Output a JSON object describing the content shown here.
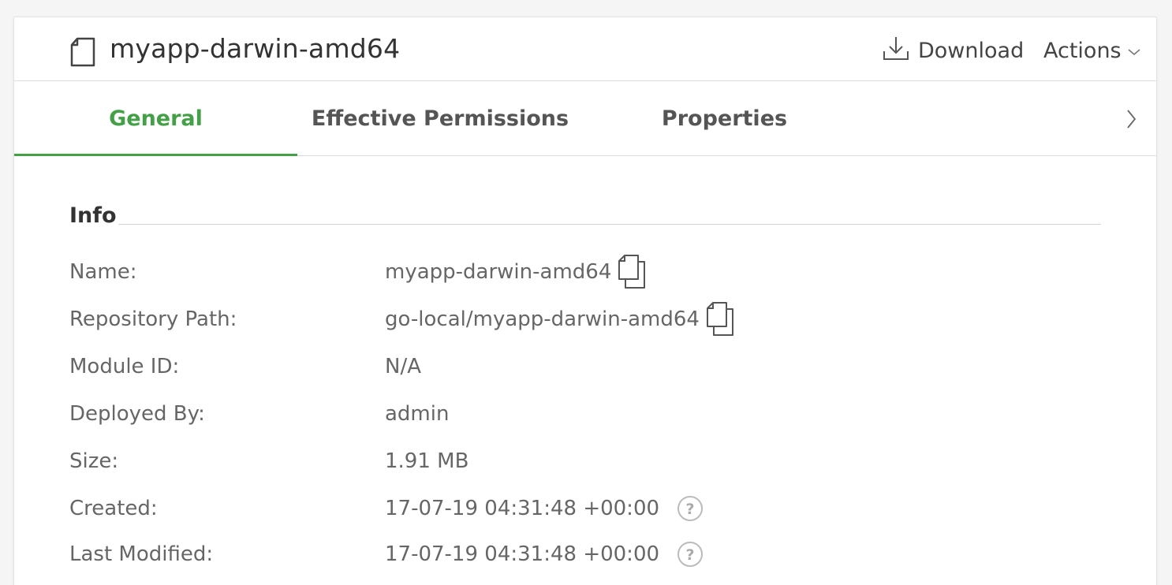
{
  "header": {
    "title": "myapp-darwin-amd64",
    "file_icon": "file-icon",
    "download_label": "Download",
    "download_icon": "download-icon",
    "actions_label": "Actions",
    "actions_icon": "chevron-down-icon"
  },
  "tabs": {
    "items": [
      {
        "label": "General",
        "active": true
      },
      {
        "label": "Effective Permissions",
        "active": false
      },
      {
        "label": "Properties",
        "active": false
      }
    ],
    "next_icon": "chevron-right-icon"
  },
  "info": {
    "section_title": "Info",
    "rows": {
      "name": {
        "label": "Name:",
        "value": "myapp-darwin-amd64"
      },
      "repo_path": {
        "label": "Repository Path:",
        "value": "go-local/myapp-darwin-amd64"
      },
      "module_id": {
        "label": "Module ID:",
        "value": "N/A"
      },
      "deployed_by": {
        "label": "Deployed By:",
        "value": "admin"
      },
      "size": {
        "label": "Size:",
        "value": "1.91 MB"
      },
      "created": {
        "label": "Created:",
        "value": "17-07-19 04:31:48 +00:00"
      },
      "last_modified": {
        "label": "Last Modified:",
        "value": "17-07-19 04:31:48 +00:00"
      }
    }
  },
  "colors": {
    "accent": "#43a047",
    "background": "#f5f5f5",
    "card": "#ffffff"
  }
}
